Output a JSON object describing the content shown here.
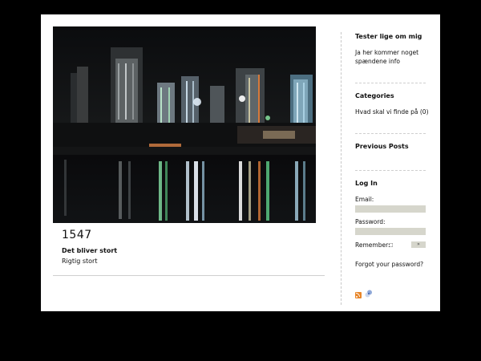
{
  "post": {
    "title": "1547",
    "subtitle": "Det bliver stort",
    "body": "Rigtig stort"
  },
  "sidebar": {
    "about": {
      "title": "Tester lige om mig",
      "text": "Ja her kommer noget spændene info"
    },
    "categories": {
      "title": "Categories",
      "items": [
        {
          "label": "Hvad skal vi finde på (0)"
        }
      ]
    },
    "previous_posts": {
      "title": "Previous Posts"
    },
    "login": {
      "title": "Log In",
      "email_label": "Email:",
      "email_value": "",
      "password_label": "Password:",
      "password_value": "",
      "remember_label": "Remember:",
      "forgot_label": "Forgot your password?"
    }
  },
  "colors": {
    "page_background": "#000000",
    "content_background": "#ffffff",
    "input_fill": "#d6d6cc",
    "rss_orange": "#e8862a"
  },
  "icons": {
    "rss": "rss-feed-icon",
    "feed": "feed-reader-icon"
  }
}
